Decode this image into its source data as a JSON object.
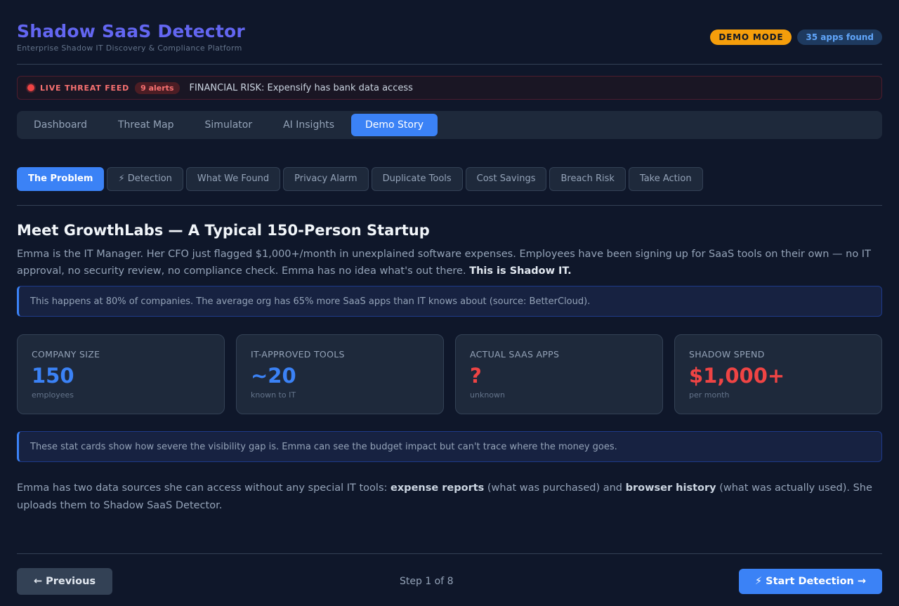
{
  "header": {
    "title_icon": "",
    "title": "Shadow SaaS Detector",
    "subtitle": "Enterprise Shadow IT Discovery & Compliance Platform",
    "demo_badge": "DEMO MODE",
    "apps_badge": "35 apps found"
  },
  "threat_feed": {
    "label": "LIVE THREAT FEED",
    "alerts": "9 alerts",
    "message": " FINANCIAL RISK: Expensify has bank data access"
  },
  "nav": {
    "items": [
      {
        "label": " Dashboard"
      },
      {
        "label": " Threat Map"
      },
      {
        "label": " Simulator"
      },
      {
        "label": " AI Insights"
      },
      {
        "label": " Demo Story"
      }
    ],
    "active_index": 4
  },
  "steps": {
    "items": [
      {
        "label": " The Problem"
      },
      {
        "label": "⚡ Detection"
      },
      {
        "label": " What We Found"
      },
      {
        "label": " Privacy Alarm"
      },
      {
        "label": " Duplicate Tools"
      },
      {
        "label": " Cost Savings"
      },
      {
        "label": " Breach Risk"
      },
      {
        "label": " Take Action"
      }
    ],
    "active_index": 0
  },
  "content": {
    "heading": " Meet GrowthLabs — A Typical 150-Person Startup",
    "intro": "Emma is the IT Manager. Her CFO just flagged $1,000+/month in unexplained software expenses. Employees have been signing up for SaaS tools on their own — no IT approval, no security review, no compliance check. Emma has no idea what's out there.",
    "intro_bold": "This is Shadow IT.",
    "note1": " This happens at 80% of companies. The average org has 65% more SaaS apps than IT knows about (source: BetterCloud).",
    "stats": [
      {
        "label": "COMPANY SIZE",
        "value": "150",
        "sub": "employees",
        "color": "#3b82f6"
      },
      {
        "label": "IT-APPROVED TOOLS",
        "value": "~20",
        "sub": "known to IT",
        "color": "#3b82f6"
      },
      {
        "label": "ACTUAL SAAS APPS",
        "value": "?",
        "sub": "unknown",
        "color": "#ef4444"
      },
      {
        "label": "SHADOW SPEND",
        "value": "$1,000+",
        "sub": "per month",
        "color": "#ef4444"
      }
    ],
    "note2": " These stat cards show how severe the visibility gap is. Emma can see the budget impact but can't trace where the money goes.",
    "outro_1": "Emma has two data sources she can access without any special IT tools: ",
    "outro_b1": "expense reports",
    "outro_2": " (what was purchased) and ",
    "outro_b2": "browser history",
    "outro_3": " (what was actually used). She uploads them to Shadow SaaS Detector."
  },
  "footer": {
    "previous": "← Previous",
    "step_indicator": "Step 1 of 8",
    "next": "⚡ Start Detection →"
  }
}
